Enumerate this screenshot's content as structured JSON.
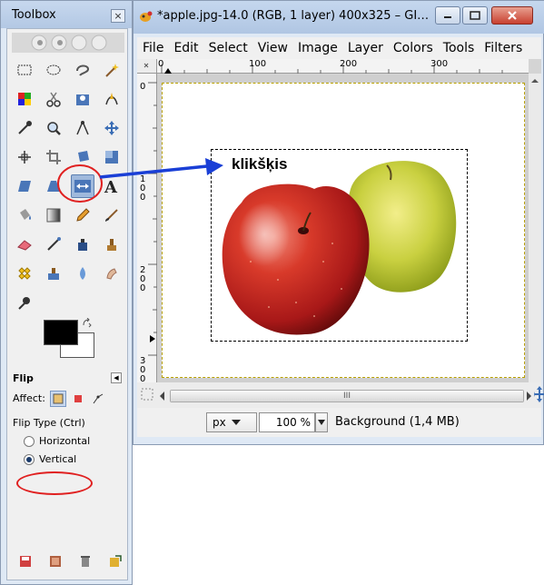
{
  "toolbox": {
    "title": "Toolbox",
    "close_glyph": "×",
    "icons": [
      "rect-select-icon",
      "ellipse-select-icon",
      "free-select-icon",
      "fuzzy-select-icon",
      "color-select-icon",
      "scissors-select-icon",
      "foreground-select-icon",
      "paths-icon",
      "color-picker-icon",
      "zoom-icon",
      "measure-icon",
      "move-icon",
      "align-icon",
      "crop-icon",
      "rotate-icon",
      "scale-icon",
      "shear-icon",
      "perspective-icon",
      "flip-icon",
      "text-icon",
      "bucket-fill-icon",
      "blend-icon",
      "pencil-icon",
      "paintbrush-icon",
      "eraser-icon",
      "airbrush-icon",
      "ink-icon",
      "clone-icon",
      "heal-icon",
      "perspective-clone-icon",
      "blur-icon",
      "smudge-icon",
      "dodge-burn-icon"
    ],
    "active_tool": "flip-icon",
    "colors": {
      "foreground": "#000000",
      "background": "#ffffff"
    },
    "options": {
      "title": "Flip",
      "affect_label": "Affect:",
      "flip_type_label": "Flip Type  (Ctrl)",
      "horizontal_label": "Horizontal",
      "vertical_label": "Vertical",
      "selected": "Vertical"
    }
  },
  "image_window": {
    "title": "*apple.jpg-14.0 (RGB, 1 layer) 400x325 – GI…",
    "menu": [
      "File",
      "Edit",
      "Select",
      "View",
      "Image",
      "Layer",
      "Colors",
      "Tools",
      "Filters"
    ],
    "hruler_labels": [
      "0",
      "100",
      "200",
      "300"
    ],
    "vruler_labels": [
      "0",
      "1\n0\n0",
      "2\n0\n0",
      "3\n0\n0"
    ],
    "unit": "px",
    "zoom": "100 %",
    "status": "Background (1,4 MB)",
    "scroll_grip": "III"
  },
  "annotation": {
    "label": "klikšķis",
    "color": "#e02020",
    "arrow_color": "#1a3fd6"
  }
}
